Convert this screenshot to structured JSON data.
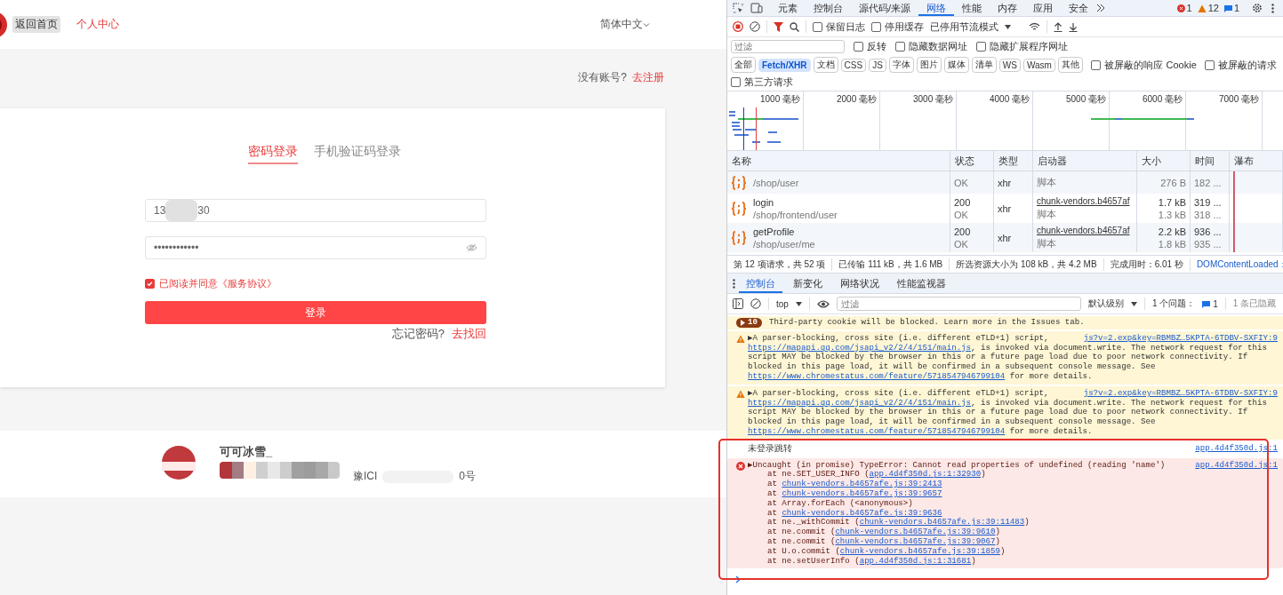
{
  "page": {
    "header": {
      "home_button": "返回首页",
      "user_center": "个人中心",
      "language": "简体中文"
    },
    "register_prompt": {
      "text": "没有账号?",
      "link": "去注册"
    },
    "login_tabs": [
      {
        "label": "密码登录",
        "selected": true
      },
      {
        "label": "手机验证码登录",
        "selected": false
      }
    ],
    "phone_field": {
      "value_start": "13",
      "value_end": "30"
    },
    "password_field": {
      "value": "••••••••••••"
    },
    "agreement": {
      "label": "已阅读并同意《服务协议》",
      "checked": true
    },
    "login_button": "登录",
    "forgot": {
      "text": "忘记密码?",
      "link": "去找回"
    },
    "footer": {
      "name": "可可冰雪_",
      "icp_start": "豫ICI",
      "icp_end": "0号"
    }
  },
  "devtools": {
    "panel_tabs": [
      {
        "label": "元素",
        "selected": false
      },
      {
        "label": "控制台",
        "selected": false
      },
      {
        "label": "源代码/来源",
        "selected": false
      },
      {
        "label": "网络",
        "selected": true
      },
      {
        "label": "性能",
        "selected": false
      },
      {
        "label": "内存",
        "selected": false
      },
      {
        "label": "应用",
        "selected": false
      },
      {
        "label": "安全",
        "selected": false
      }
    ],
    "counts": {
      "errors": "1",
      "warnings": "12",
      "info": "1"
    },
    "toolbar_checkboxes": [
      {
        "label": "保留日志",
        "checked": false
      },
      {
        "label": "停用缓存",
        "checked": false
      }
    ],
    "throttling": "已停用节流模式",
    "filter": {
      "placeholder": "过滤"
    },
    "filter_checkboxes": [
      {
        "label": "反转",
        "checked": false
      },
      {
        "label": "隐藏数据网址",
        "checked": false
      },
      {
        "label": "隐藏扩展程序网址",
        "checked": false
      }
    ],
    "type_filters": [
      {
        "label": "全部",
        "selected": false
      },
      {
        "label": "Fetch/XHR",
        "selected": true
      },
      {
        "label": "文档",
        "selected": false
      },
      {
        "label": "CSS",
        "selected": false
      },
      {
        "label": "JS",
        "selected": false
      },
      {
        "label": "字体",
        "selected": false
      },
      {
        "label": "图片",
        "selected": false
      },
      {
        "label": "媒体",
        "selected": false
      },
      {
        "label": "清单",
        "selected": false
      },
      {
        "label": "WS",
        "selected": false
      },
      {
        "label": "Wasm",
        "selected": false
      },
      {
        "label": "其他",
        "selected": false
      }
    ],
    "blocked_checkboxes": [
      {
        "label": "被屏蔽的响应 Cookie",
        "checked": false
      },
      {
        "label": "被屏蔽的请求",
        "checked": false
      }
    ],
    "third_party_checkbox": {
      "label": "第三方请求",
      "checked": false
    },
    "timeline_ticks": [
      "1000 毫秒",
      "2000 毫秒",
      "3000 毫秒",
      "4000 毫秒",
      "5000 毫秒",
      "6000 毫秒",
      "7000 毫秒"
    ],
    "table": {
      "columns": [
        "名称",
        "状态",
        "类型",
        "启动器",
        "大小",
        "时间",
        "瀑布"
      ],
      "rows": [
        {
          "path": "/shop/user",
          "status_text": "OK",
          "type": "xhr",
          "initiator_type": "脚本",
          "resource_size": "276 B",
          "time_sub": "182 ..."
        },
        {
          "name": "login",
          "path": "/shop/frontend/user",
          "status": "200",
          "status_text": "OK",
          "type": "xhr",
          "initiator": "chunk-vendors.b4657af",
          "initiator_type": "脚本",
          "size": "1.7 kB",
          "resource_size": "1.3 kB",
          "time": "319 ...",
          "time_sub": "318 ..."
        },
        {
          "name": "getProfile",
          "path": "/shop/user/me",
          "status": "200",
          "status_text": "OK",
          "type": "xhr",
          "initiator": "chunk-vendors.b4657af",
          "initiator_type": "脚本",
          "size": "2.2 kB",
          "resource_size": "1.8 kB",
          "time": "936 ...",
          "time_sub": "935 ..."
        }
      ]
    },
    "status_bar": [
      {
        "text": "第 12 项请求，共 52 项",
        "kind": "text"
      },
      {
        "text": "已传输 111 kB，共 1.6 MB",
        "kind": "text"
      },
      {
        "text": "所选资源大小为 108 kB，共 4.2 MB",
        "kind": "text"
      },
      {
        "text": "完成用时：6.01 秒",
        "kind": "text"
      },
      {
        "text": "DOMContentLoaded：",
        "kind": "link"
      }
    ],
    "drawer_tabs": [
      {
        "label": "控制台",
        "selected": true
      },
      {
        "label": "新变化",
        "selected": false
      },
      {
        "label": "网络状况",
        "selected": false
      },
      {
        "label": "性能监视器",
        "selected": false
      }
    ],
    "console_toolbar": {
      "context": "top",
      "filter_placeholder": "过滤",
      "level": "默认级别",
      "issues_label": "1 个问题：",
      "issues_count": "1",
      "hidden": "1 条已隐藏"
    },
    "messages": [
      {
        "kind": "issue",
        "count": "10",
        "text": "Third-party cookie will be blocked. Learn more in the Issues tab."
      },
      {
        "kind": "warning",
        "source": "js?v=2.exp&key=RBMBZ…5KPTA-6TDBV-SXFIY:9",
        "parts": [
          {
            "text": "▶A parser-blocking, cross site (i.e. different eTLD+1) script, "
          },
          {
            "link": "https://mapapi.qq.com/jsapi_v2/2/4/151/main.js"
          },
          {
            "text": ", is invoked via document.write. The network request for this script MAY be blocked by the browser in this or a future page load due to poor network connectivity. If blocked in this page load, it will be confirmed in a subsequent console message. See "
          },
          {
            "link": "https://www.chromestatus.com/feature/5718547946799104"
          },
          {
            "text": " for more details."
          }
        ]
      },
      {
        "kind": "warning",
        "source": "js?v=2.exp&key=RBMBZ…5KPTA-6TDBV-SXFIY:9",
        "parts": [
          {
            "text": "▶A parser-blocking, cross site (i.e. different eTLD+1) script, "
          },
          {
            "link": "https://mapapi.qq.com/jsapi_v2/2/4/151/main.js"
          },
          {
            "text": ", is invoked via document.write. The network request for this script MAY be blocked by the browser in this or a future page load due to poor network connectivity. If blocked in this page load, it will be confirmed in a subsequent console message. See "
          },
          {
            "link": "https://www.chromestatus.com/feature/5718547946799104"
          },
          {
            "text": " for more details."
          }
        ]
      },
      {
        "kind": "log",
        "text": "未登录跳转",
        "source": "app.4d4f350d.js:1"
      },
      {
        "kind": "error",
        "source": "app.4d4f350d.js:1",
        "text": "▶Uncaught (in promise) TypeError: Cannot read properties of undefined (reading 'name')",
        "stack": [
          {
            "before": "at ne.SET_USER_INFO (",
            "link": "app.4d4f350d.js:1:32930",
            "after": ")"
          },
          {
            "before": "at ",
            "link": "chunk-vendors.b4657afe.js:39:2413"
          },
          {
            "before": "at ",
            "link": "chunk-vendors.b4657afe.js:39:9657"
          },
          {
            "before": "at Array.forEach (<anonymous>)"
          },
          {
            "before": "at ",
            "link": "chunk-vendors.b4657afe.js:39:9636"
          },
          {
            "before": "at ne._withCommit (",
            "link": "chunk-vendors.b4657afe.js:39:11483",
            "after": ")"
          },
          {
            "before": "at ne.commit (",
            "link": "chunk-vendors.b4657afe.js:39:9610",
            "after": ")"
          },
          {
            "before": "at ne.commit (",
            "link": "chunk-vendors.b4657afe.js:39:9067",
            "after": ")"
          },
          {
            "before": "at U.o.commit (",
            "link": "chunk-vendors.b4657afe.js:39:1859",
            "after": ")"
          },
          {
            "before": "at ne.setUserInfo (",
            "link": "app.4d4f350d.js:1:31681",
            "after": ")"
          }
        ]
      }
    ]
  }
}
